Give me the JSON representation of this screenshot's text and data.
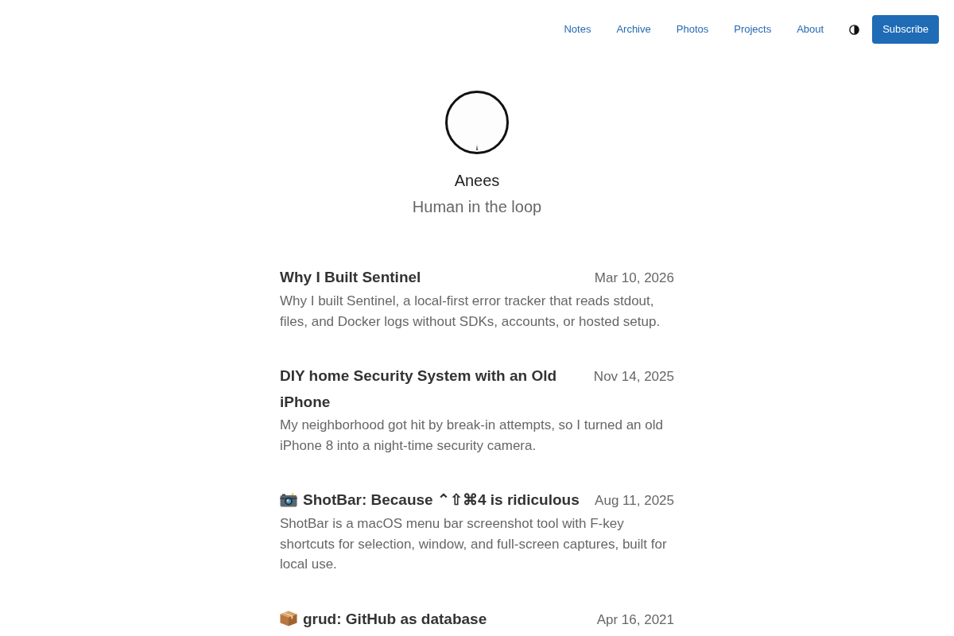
{
  "nav": {
    "links": [
      "Notes",
      "Archive",
      "Photos",
      "Projects",
      "About"
    ],
    "subscribe": "Subscribe"
  },
  "profile": {
    "name": "Anees",
    "tagline": "Human in the loop"
  },
  "posts": [
    {
      "kind": "plain",
      "title": "Why I Built Sentinel",
      "date": "Mar 10, 2026",
      "summary": "Why I built Sentinel, a local-first error tracker that reads stdout, files, and Docker logs without SDKs, accounts, or hosted setup."
    },
    {
      "kind": "plain",
      "title": "DIY home Security System with an Old iPhone",
      "date": "Nov 14, 2025",
      "summary": "My neighborhood got hit by break-in attempts, so I turned an old iPhone 8 into a night-time security camera."
    },
    {
      "kind": "camera",
      "title": "ShotBar: Because ⌃⇧⌘4 is ridiculous",
      "date": "Aug 11, 2025",
      "summary": "ShotBar is a macOS menu bar screenshot tool with F-key shortcuts for selection, window, and full-screen captures, built for local use."
    },
    {
      "kind": "package",
      "title": "grud: GitHub as database",
      "date": "Apr 16, 2021"
    }
  ]
}
